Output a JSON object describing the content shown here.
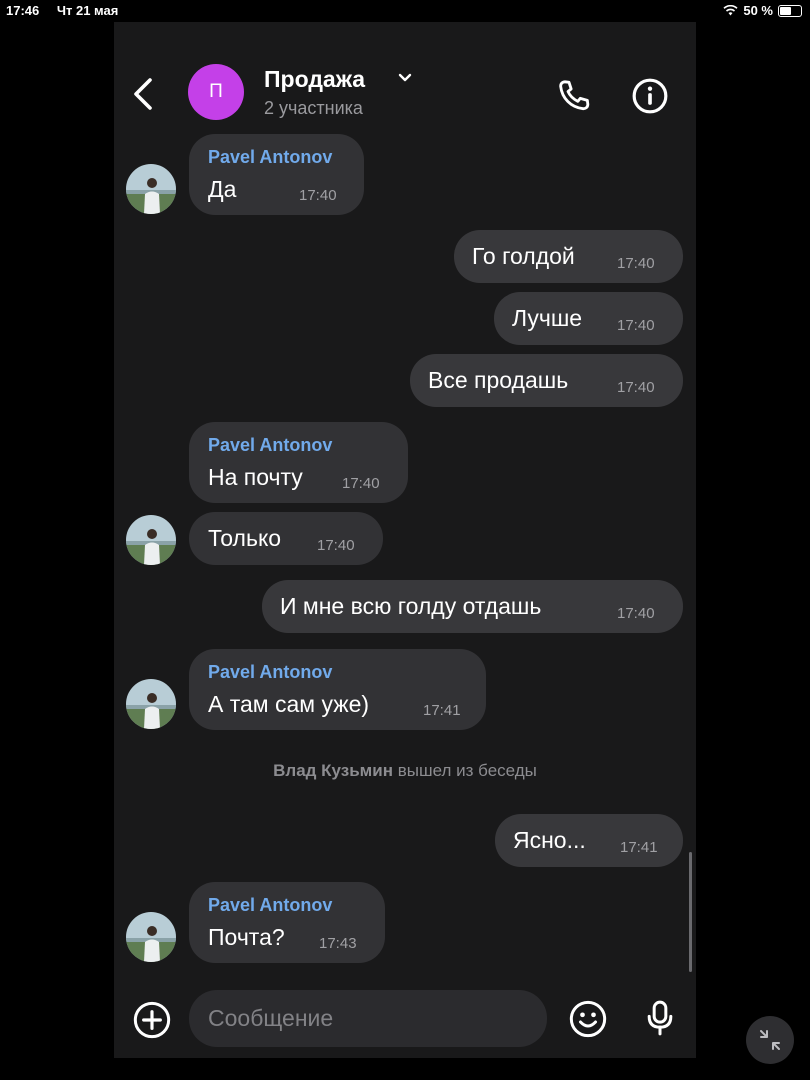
{
  "status_bar": {
    "time": "17:46",
    "date": "Чт 21 мая",
    "battery": "50 %"
  },
  "header": {
    "avatar_letter": "П",
    "title": "Продажа",
    "subtitle": "2 участника"
  },
  "messages": [
    {
      "sender": "Pavel Antonov",
      "text": "Да",
      "time": "17:40"
    },
    {
      "text": "Го голдой",
      "time": "17:40"
    },
    {
      "text": "Лучше",
      "time": "17:40"
    },
    {
      "text": "Все продашь",
      "time": "17:40"
    },
    {
      "sender": "Pavel Antonov",
      "text": "На почту",
      "time": "17:40"
    },
    {
      "text": "Только",
      "time": "17:40"
    },
    {
      "text": "И мне всю голду отдашь",
      "time": "17:40"
    },
    {
      "sender": "Pavel Antonov",
      "text": "А там сам уже)",
      "time": "17:41"
    },
    {
      "text": "Ясно...",
      "time": "17:41"
    },
    {
      "sender": "Pavel Antonov",
      "text": "Почта?",
      "time": "17:43"
    }
  ],
  "system_message": {
    "name": "Влад Кузьмин",
    "text": "вышел из беседы"
  },
  "composer": {
    "placeholder": "Сообщение"
  },
  "icons": {
    "back": "chevron-left-icon",
    "caret": "chevron-down-icon",
    "call": "phone-icon",
    "info": "info-icon",
    "attach": "plus-circle-icon",
    "emoji": "smile-icon",
    "voice": "microphone-icon",
    "collapse": "collapse-arrows-icon"
  },
  "colors": {
    "background": "#19191a",
    "bubble": "#323235",
    "sender_name": "#71aaeb",
    "avatar": "#c440e8"
  }
}
